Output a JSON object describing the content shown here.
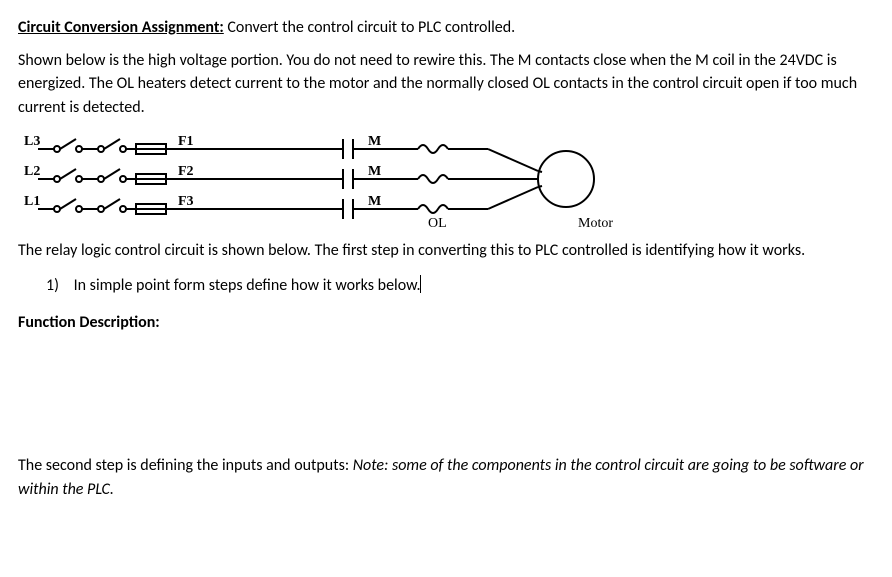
{
  "title": "Circuit Conversion Assignment:",
  "titleTail": " Convert the control circuit to PLC controlled.",
  "intro": "Shown below is the high voltage portion. You do not need to rewire this. The M contacts close when the M coil in the 24VDC is energized. The OL heaters detect current to the motor and the normally closed OL contacts in the control circuit open if too much current is detected.",
  "diagram": {
    "lines": [
      "L3",
      "L2",
      "L1"
    ],
    "fuses": [
      "F1",
      "F2",
      "F3"
    ],
    "contactLabel": "M",
    "olLabel": "OL",
    "motorLabel": "Motor"
  },
  "afterDiagram": "The relay logic control circuit is shown below. The first step in converting this to PLC controlled is identifying how it works.",
  "question1": {
    "num": "1)",
    "text": "In simple point form steps define how it works below."
  },
  "functionHead": "Function Description:",
  "bottomLead": "The second step is defining the inputs and outputs: ",
  "bottomItalic": "Note: some of the components in the control circuit are going to be software or within the PLC."
}
